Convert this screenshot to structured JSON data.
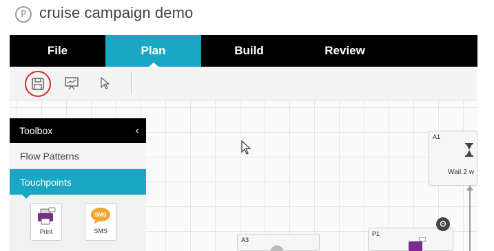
{
  "header": {
    "logo_letter": "P",
    "title": "cruise campaign demo"
  },
  "nav": {
    "tabs": [
      {
        "label": "File",
        "active": false
      },
      {
        "label": "Plan",
        "active": true
      },
      {
        "label": "Build",
        "active": false
      },
      {
        "label": "Review",
        "active": false
      }
    ]
  },
  "toolbar": {
    "tools": [
      "save-icon",
      "presentation-icon",
      "pointer-icon"
    ]
  },
  "toolbox": {
    "title": "Toolbox",
    "collapse_glyph": "‹",
    "items": [
      {
        "label": "Flow Patterns",
        "active": false
      },
      {
        "label": "Touchpoints",
        "active": true
      }
    ],
    "touchpoints": [
      {
        "label": "Print",
        "icon": "printer-icon"
      },
      {
        "label": "SMS",
        "icon": "sms-icon",
        "icon_text": "SMS"
      }
    ]
  },
  "canvas": {
    "nodes": [
      {
        "id": "A1",
        "label": "Wait 2 w",
        "icon": "hourglass-icon"
      },
      {
        "id": "A3"
      },
      {
        "id": "P1",
        "icon": "printer-icon"
      }
    ]
  },
  "colors": {
    "accent": "#1aa7c4",
    "nav_bg": "#000000",
    "highlight_circle": "#d9262b",
    "print_icon": "#7b2c8c",
    "sms_icon": "#f0a531"
  }
}
